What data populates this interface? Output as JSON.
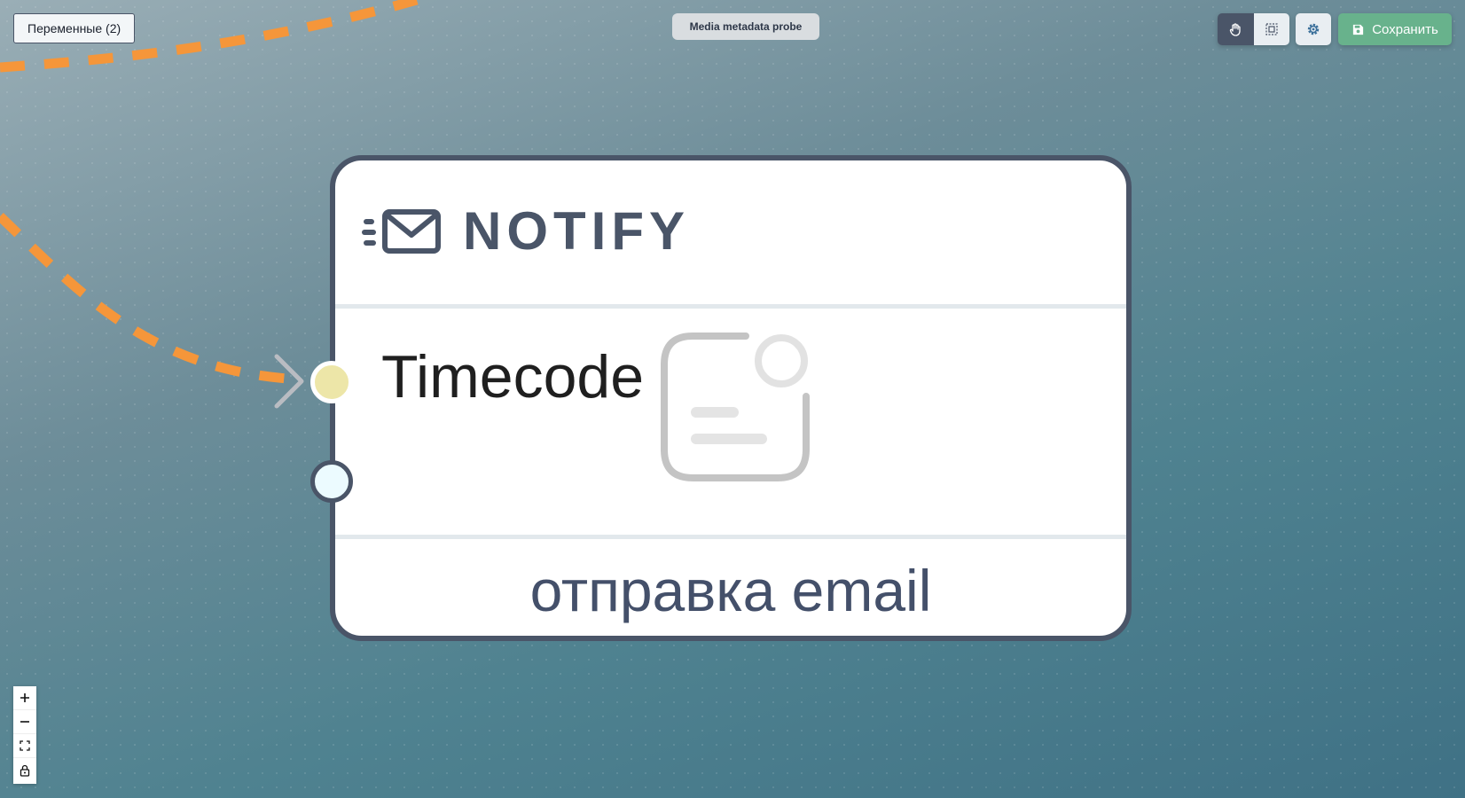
{
  "toolbar": {
    "variables_label": "Переменные (2)",
    "flow_title": "Media metadata probe",
    "save_label": "Сохранить",
    "pan_tool_icon": "hand-icon",
    "select_tool_icon": "selection-box-icon",
    "settings_icon": "gear-icon",
    "save_icon": "floppy-disk-icon"
  },
  "node": {
    "type_label": "NOTIFY",
    "type_icon": "envelope-fast-icon",
    "input_port_label": "Timecode",
    "placeholder_icon": "notification-card-icon",
    "description": "отправка email"
  },
  "controls": {
    "zoom_in_icon": "plus-icon",
    "zoom_out_icon": "minus-icon",
    "fit_view_icon": "fit-view-icon",
    "lock_icon": "lock-icon"
  },
  "colors": {
    "edge": "#f5963a",
    "node_border": "#4a5568",
    "save_button": "#68b28c",
    "input_port": "#ede6a8",
    "output_port": "#ecfbff"
  }
}
